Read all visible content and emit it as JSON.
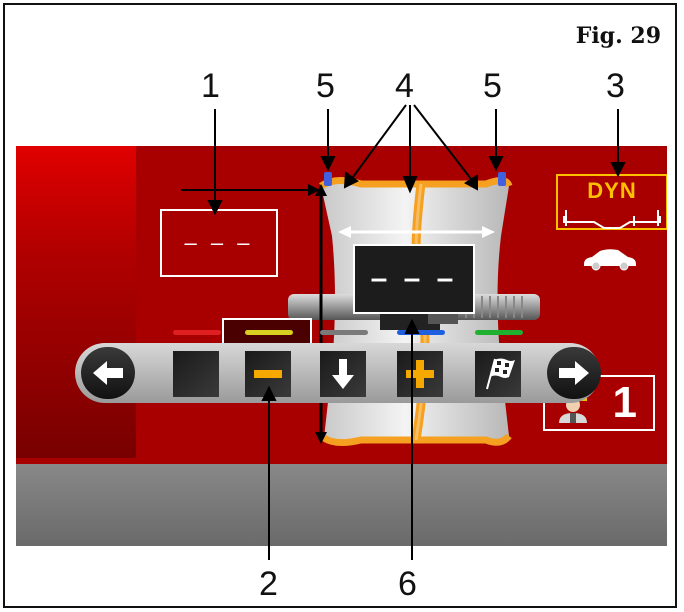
{
  "figure": {
    "label": "Fig.  29"
  },
  "callouts": {
    "c1": "1",
    "c2": "2",
    "c3": "3",
    "c4": "4",
    "c5a": "5",
    "c5b": "5",
    "c6": "6"
  },
  "screen": {
    "distance_value": "– – –",
    "diameter_value": "– – –",
    "width_value": "– – –",
    "mode_label": "DYN",
    "operator_number": "1"
  },
  "toolbar": {
    "buttons": [
      {
        "name": "back",
        "icon": "arrow-left-icon"
      },
      {
        "name": "blank",
        "icon": "none"
      },
      {
        "name": "minus",
        "icon": "minus-icon"
      },
      {
        "name": "down",
        "icon": "arrow-down-icon"
      },
      {
        "name": "plus",
        "icon": "plus-icon"
      },
      {
        "name": "finish",
        "icon": "checkered-flag-icon"
      },
      {
        "name": "forward",
        "icon": "arrow-right-icon"
      }
    ],
    "leds": [
      {
        "color": "#e02020"
      },
      {
        "color": "#d8d020"
      },
      {
        "color": "#7a7a7a"
      },
      {
        "color": "#2060e0"
      },
      {
        "color": "#20b030"
      }
    ]
  },
  "colors": {
    "accent": "#ffc000",
    "screen_bg": "#a80000"
  }
}
